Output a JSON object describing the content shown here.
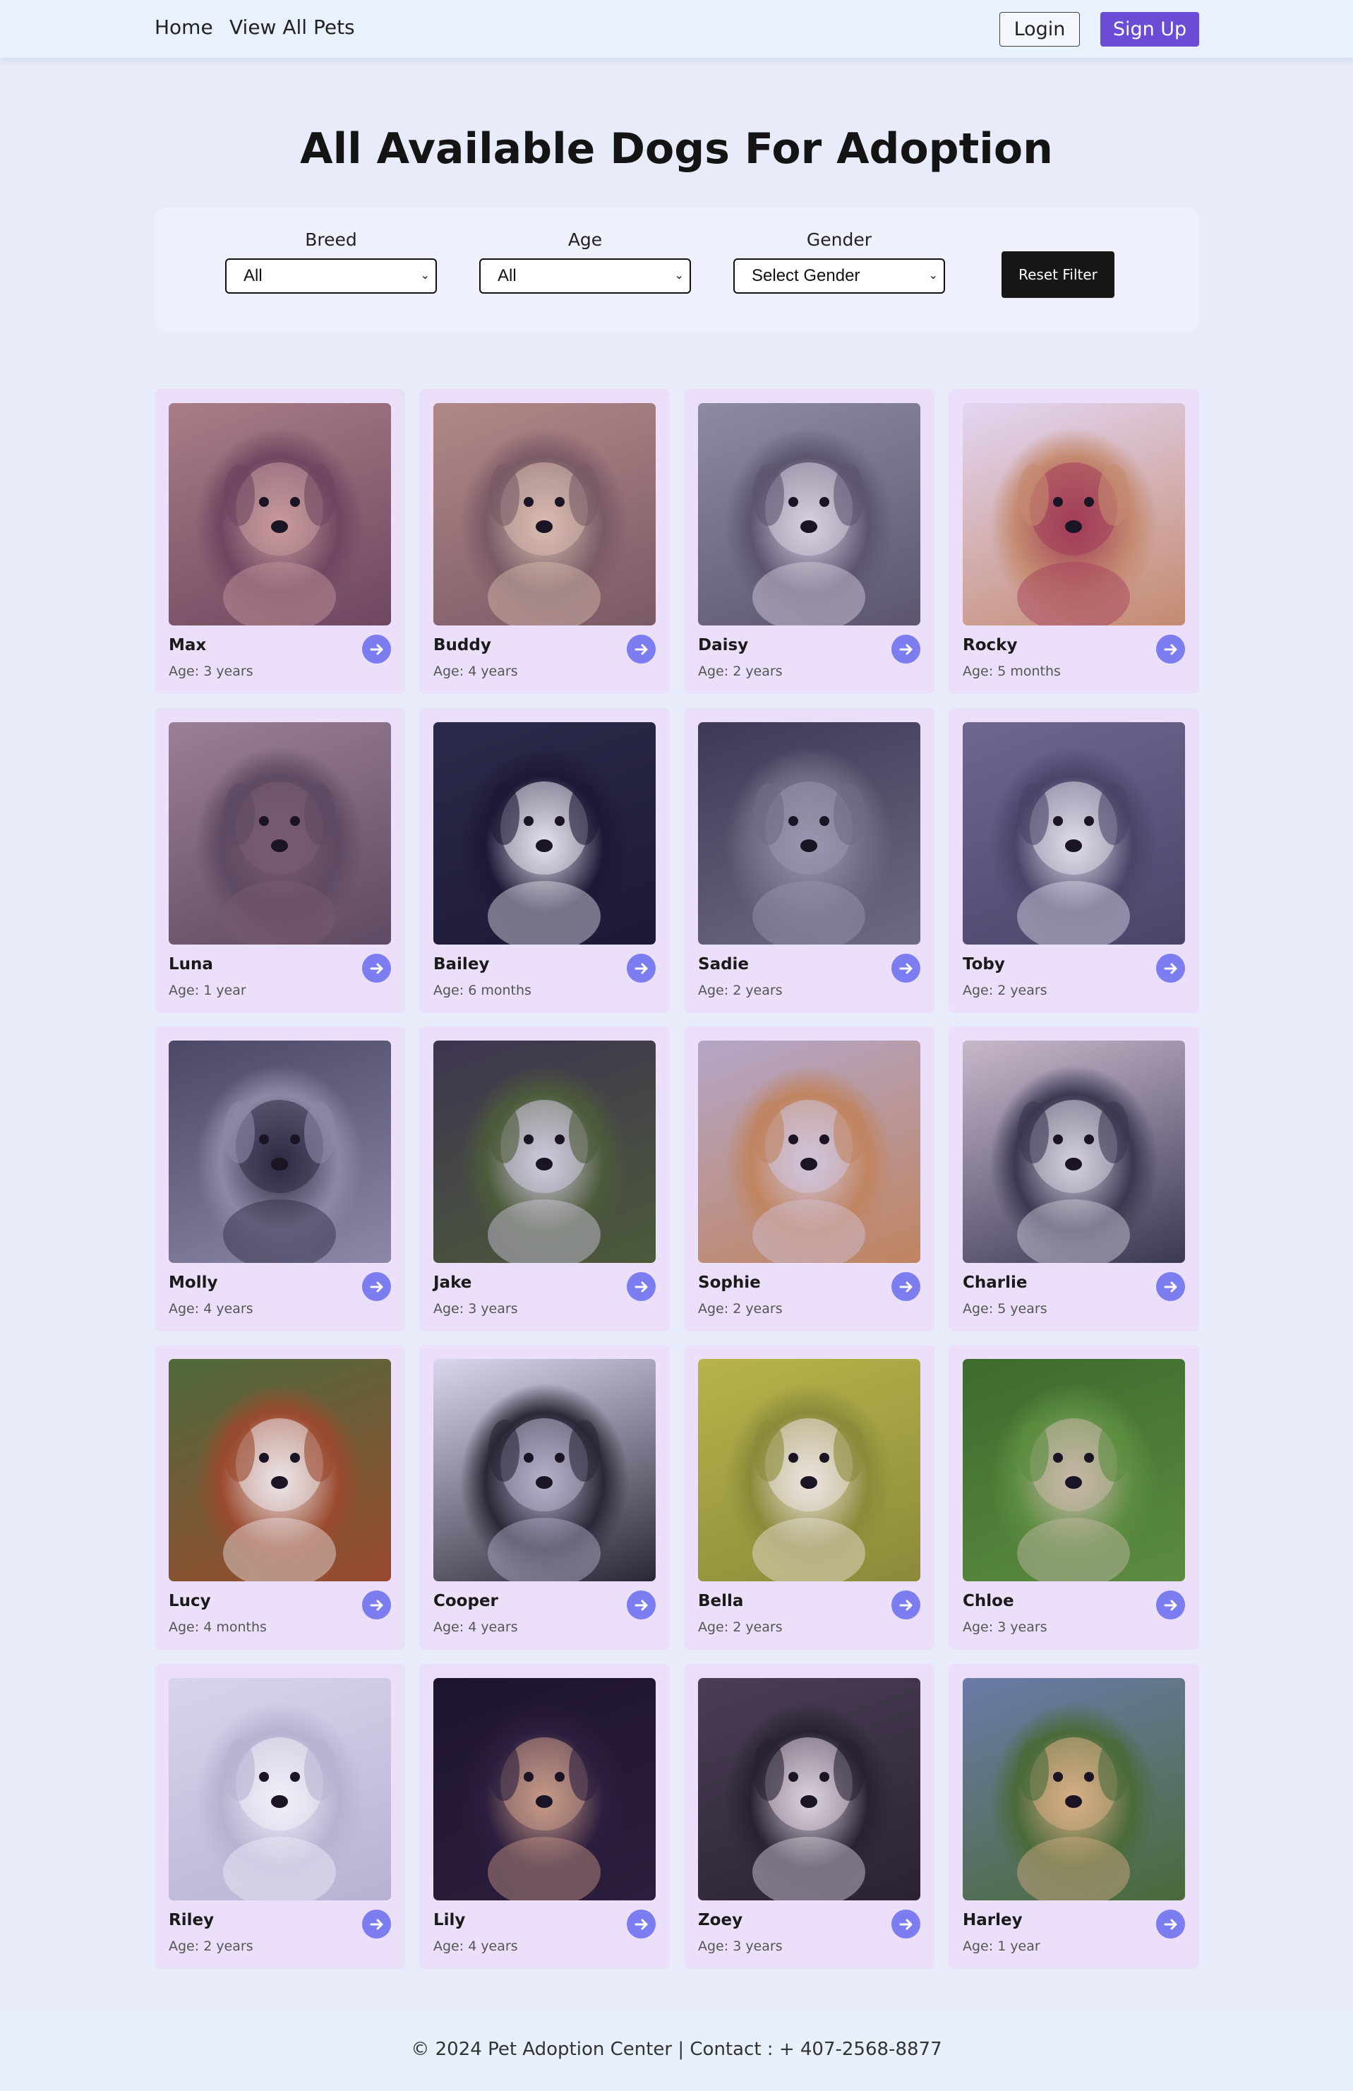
{
  "nav": {
    "home": "Home",
    "view_all_pets": "View All Pets",
    "login": "Login",
    "sign_up": "Sign Up"
  },
  "page_title": "All Available Dogs For Adoption",
  "filters": {
    "breed": {
      "label": "Breed",
      "value": "All"
    },
    "age": {
      "label": "Age",
      "value": "All"
    },
    "gender": {
      "label": "Gender",
      "value": "Select Gender"
    },
    "reset_label": "Reset Filter"
  },
  "pets": [
    {
      "name": "Max",
      "age": "Age: 3 years",
      "colors": [
        "#a87d86",
        "#6e4660",
        "#c99a9e"
      ]
    },
    {
      "name": "Buddy",
      "age": "Age: 4 years",
      "colors": [
        "#b08888",
        "#7a5a66",
        "#d9bcb0"
      ]
    },
    {
      "name": "Daisy",
      "age": "Age: 2 years",
      "colors": [
        "#8c8aa5",
        "#5d5570",
        "#d9d0e0"
      ]
    },
    {
      "name": "Rocky",
      "age": "Age: 5 months",
      "colors": [
        "#e3d6f3",
        "#c48a70",
        "#a33c5a"
      ]
    },
    {
      "name": "Luna",
      "age": "Age: 1 year",
      "colors": [
        "#9a7f96",
        "#5e4a62",
        "#7a5c72"
      ]
    },
    {
      "name": "Bailey",
      "age": "Age: 6 months",
      "colors": [
        "#2c2a4a",
        "#1b1936",
        "#e6e2ee"
      ]
    },
    {
      "name": "Sadie",
      "age": "Age: 2 years",
      "colors": [
        "#3c3a58",
        "#6e6a84",
        "#9a96ae"
      ]
    },
    {
      "name": "Toby",
      "age": "Age: 2 years",
      "colors": [
        "#6e6890",
        "#4a4468",
        "#e0dcea"
      ]
    },
    {
      "name": "Molly",
      "age": "Age: 4 years",
      "colors": [
        "#4a4866",
        "#8c88a6",
        "#2c2a44"
      ]
    },
    {
      "name": "Jake",
      "age": "Age: 3 years",
      "colors": [
        "#3e3550",
        "#4c5a3a",
        "#d0cae0"
      ]
    },
    {
      "name": "Sophie",
      "age": "Age: 2 years",
      "colors": [
        "#b4a6c8",
        "#c08460",
        "#d0c4dc"
      ]
    },
    {
      "name": "Charlie",
      "age": "Age: 5 years",
      "colors": [
        "#c8b8cc",
        "#3a3852",
        "#d6d0de"
      ]
    },
    {
      "name": "Lucy",
      "age": "Age: 4 months",
      "colors": [
        "#4f6a3c",
        "#9a4a2e",
        "#ece6ea"
      ]
    },
    {
      "name": "Cooper",
      "age": "Age: 4 years",
      "colors": [
        "#dcd6ec",
        "#2a2838",
        "#b8b2cc"
      ]
    },
    {
      "name": "Bella",
      "age": "Age: 2 years",
      "colors": [
        "#b6b44a",
        "#8c8a3a",
        "#ece4e0"
      ]
    },
    {
      "name": "Chloe",
      "age": "Age: 3 years",
      "colors": [
        "#3e6a2e",
        "#5c8c40",
        "#c8b8a8"
      ]
    },
    {
      "name": "Riley",
      "age": "Age: 2 years",
      "colors": [
        "#d8d4ee",
        "#b8b2d2",
        "#f2eef8"
      ]
    },
    {
      "name": "Lily",
      "age": "Age: 4 years",
      "colors": [
        "#1e1430",
        "#2c1e3e",
        "#c89a88"
      ]
    },
    {
      "name": "Zoey",
      "age": "Age: 3 years",
      "colors": [
        "#4a3e54",
        "#2a2234",
        "#ded4e0"
      ]
    },
    {
      "name": "Harley",
      "age": "Age: 1 year",
      "colors": [
        "#6c7aa8",
        "#4a6a3a",
        "#d8ae86"
      ]
    }
  ],
  "footer": "© 2024 Pet Adoption Center | Contact : + 407-2568-8877"
}
